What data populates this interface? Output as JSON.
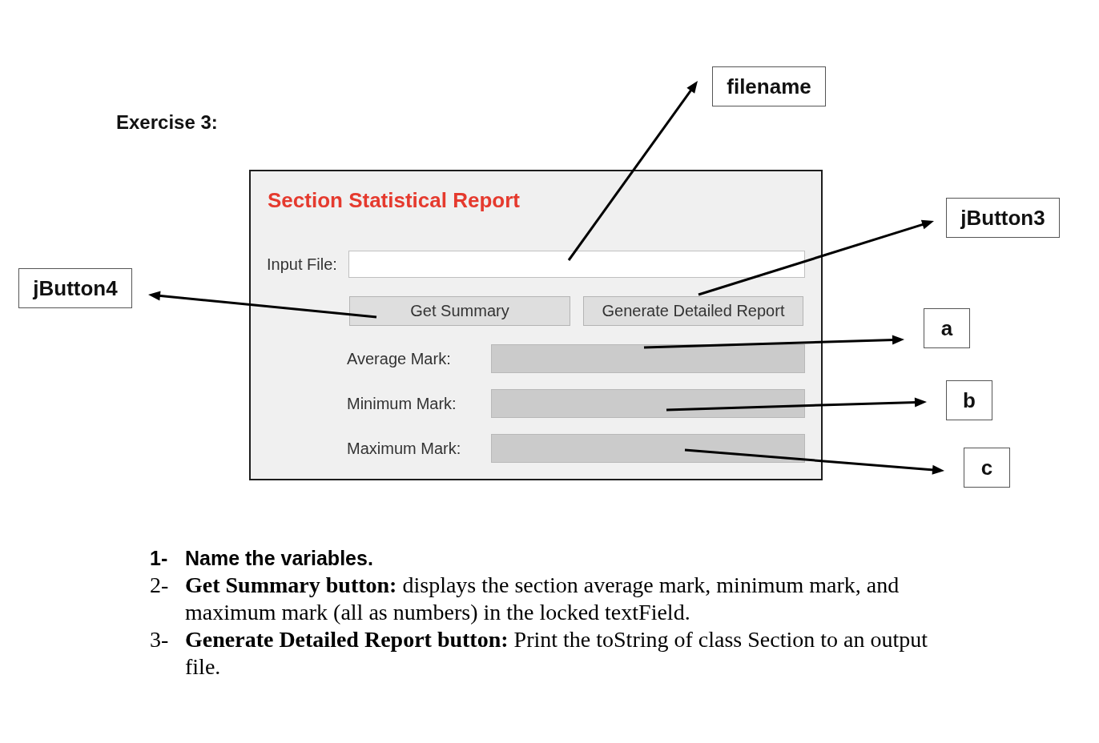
{
  "heading": "Exercise 3:",
  "form": {
    "title": "Section Statistical Report",
    "input": {
      "label": "Input File:",
      "disabled": false
    },
    "buttons": [
      "Get Summary",
      "Generate Detailed Report"
    ],
    "outputs": [
      {
        "label": "Average Mark:",
        "disabled": true
      },
      {
        "label": "Minimum Mark:",
        "disabled": true
      },
      {
        "label": "Maximum Mark:",
        "disabled": true
      }
    ]
  },
  "callouts": [
    "filename",
    "jButton3",
    "jButton4",
    "a",
    "b",
    "c"
  ],
  "instructions": [
    {
      "marker": "1-",
      "kind": "heading",
      "text": "Name the variables."
    },
    {
      "marker": "2-",
      "kind": "text",
      "text": "**Get Summary button:** displays the section average mark, minimum mark, and maximum mark (all as numbers) in the locked textField."
    },
    {
      "marker": "3-",
      "kind": "text",
      "text": "**Generate Detailed Report button:** Print the toString of class Section to an output file."
    }
  ]
}
